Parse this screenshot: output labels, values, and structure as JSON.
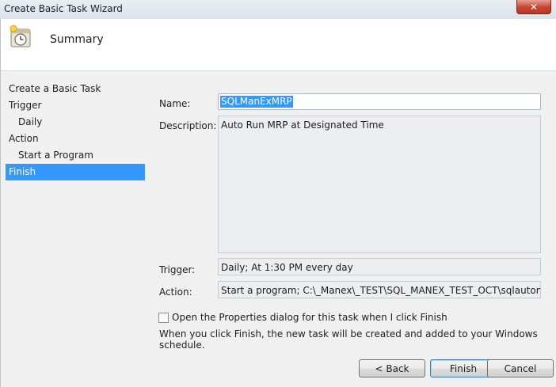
{
  "window": {
    "title": "Create Basic Task Wizard",
    "close_label": "✕"
  },
  "header": {
    "title": "Summary",
    "icon": "task-scheduler-clock-icon"
  },
  "nav": {
    "items": [
      {
        "label": "Create a Basic Task",
        "sub": false,
        "active": false
      },
      {
        "label": "Trigger",
        "sub": false,
        "active": false
      },
      {
        "label": "Daily",
        "sub": true,
        "active": false
      },
      {
        "label": "Action",
        "sub": false,
        "active": false
      },
      {
        "label": "Start a Program",
        "sub": true,
        "active": false
      },
      {
        "label": "Finish",
        "sub": false,
        "active": true
      }
    ]
  },
  "summary": {
    "name_label": "Name:",
    "name_value": "SQLManExMRP",
    "description_label": "Description:",
    "description_value": "Auto Run MRP at Designated Time",
    "trigger_label": "Trigger:",
    "trigger_value": "Daily; At 1:30 PM every day",
    "action_label": "Action:",
    "action_value": "Start a program; C:\\_Manex\\_TEST\\SQL_MANEX_TEST_OCT\\sqlautomrprun.e"
  },
  "options": {
    "open_properties_label": "Open the Properties dialog for this task when I click Finish",
    "open_properties_checked": false,
    "info_text": "When you click Finish, the new task will be created and added to your Windows schedule."
  },
  "buttons": {
    "back": "< Back",
    "finish": "Finish",
    "cancel": "Cancel"
  },
  "colors": {
    "selection": "#3399ff",
    "header_bg": "#ffffff",
    "body_bg": "#f0f0f0"
  }
}
